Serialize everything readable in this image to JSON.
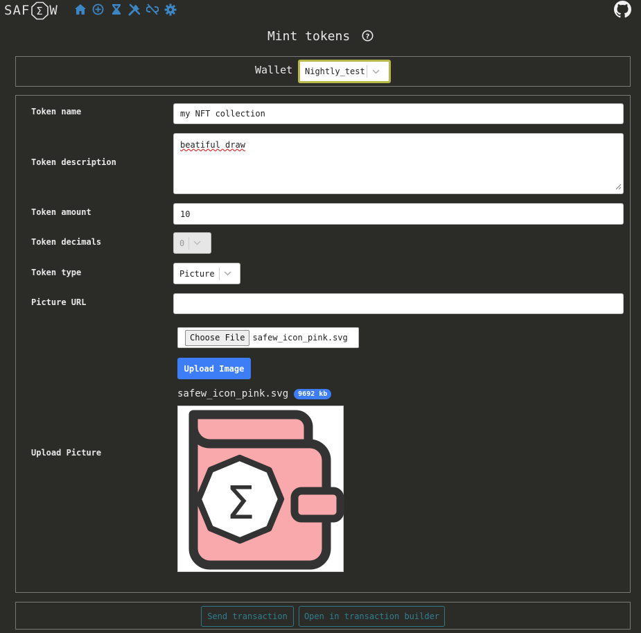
{
  "header": {
    "logo_left": "SAF",
    "logo_right": "W",
    "nav_icons": [
      "home-icon",
      "plus-circle-icon",
      "hourglass-icon",
      "tools-icon",
      "unlink-icon",
      "gear-icon"
    ],
    "github_icon": "github-icon"
  },
  "page": {
    "title": "Mint tokens"
  },
  "wallet": {
    "label": "Wallet",
    "selected": "Nightly_test"
  },
  "form": {
    "token_name_label": "Token name",
    "token_name_value": "my NFT collection",
    "token_description_label": "Token description",
    "token_description_value": "beatiful draw",
    "token_amount_label": "Token amount",
    "token_amount_value": "10",
    "token_decimals_label": "Token decimals",
    "token_decimals_value": "0",
    "token_type_label": "Token type",
    "token_type_value": "Picture",
    "picture_url_label": "Picture URL",
    "picture_url_value": "",
    "upload_picture_label": "Upload Picture",
    "choose_file_label": "Choose File",
    "chosen_file_name": "safew_icon_pink.svg",
    "upload_button_label": "Upload Image",
    "uploaded_file_name": "safew_icon_pink.svg",
    "uploaded_file_size": "9692 kb"
  },
  "actions": {
    "send_transaction": "Send transaction",
    "open_in_builder": "Open in transaction builder"
  },
  "colors": {
    "background": "#2b2b28",
    "accent_blue": "#3d7df6",
    "nav_icon_blue": "#3d86c6",
    "wallet_border": "#b8b84a",
    "outline_button": "#2f7f90",
    "picture_pink": "#f9a9ac",
    "picture_dark": "#333333"
  }
}
